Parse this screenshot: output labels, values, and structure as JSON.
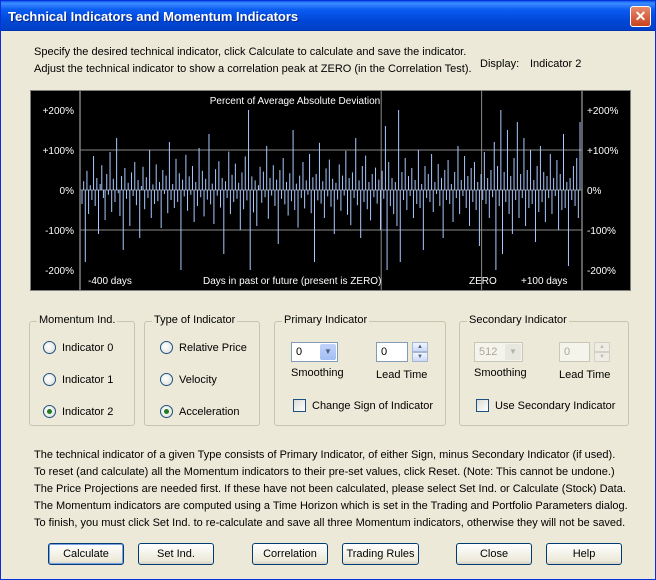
{
  "window": {
    "title": "Technical Indicators and Momentum Indicators",
    "close_label": "✕"
  },
  "instructions": {
    "line1": "Specify the desired technical indicator, click Calculate to calculate and save the indicator.",
    "line2": "Adjust the technical indicator to show a correlation peak at ZERO (in the Correlation Test).",
    "display_label": "Display:",
    "display_value": "Indicator 2"
  },
  "chart": {
    "title": "Percent of Average Absolute Deviation",
    "y_ticks": [
      "+200%",
      "+100%",
      "0%",
      "-100%",
      "-200%"
    ],
    "x_left_label": "-400 days",
    "x_center_label": "Days in past or future (present is ZERO)",
    "x_zero_label": "ZERO",
    "x_right_label": "+100 days",
    "line_color": "#a8c8ff"
  },
  "chart_data": {
    "type": "bar",
    "title": "Percent of Average Absolute Deviation",
    "xlabel": "Days in past or future (present is ZERO)",
    "ylabel": "",
    "x_range": [
      -400,
      100
    ],
    "ylim": [
      -200,
      200
    ],
    "y_unit": "%",
    "grid": true,
    "values": [
      -35,
      22,
      -180,
      48,
      -60,
      12,
      -25,
      85,
      -40,
      30,
      -110,
      15,
      62,
      -20,
      -75,
      40,
      -12,
      95,
      -55,
      28,
      -30,
      130,
      -8,
      -65,
      35,
      -150,
      55,
      -22,
      18,
      -90,
      44,
      -15,
      70,
      -38,
      25,
      -120,
      10,
      58,
      -48,
      32,
      -20,
      100,
      -70,
      14,
      -35,
      64,
      -28,
      20,
      -95,
      50,
      -10,
      36,
      -58,
      120,
      -25,
      15,
      -45,
      78,
      -30,
      42,
      -200,
      26,
      -16,
      88,
      -52,
      34,
      -12,
      60,
      -80,
      20,
      -40,
      105,
      -18,
      48,
      -66,
      28,
      -24,
      140,
      -36,
      16,
      -85,
      52,
      -14,
      72,
      -44,
      30,
      -160,
      22,
      -20,
      96,
      -60,
      38,
      -30,
      66,
      -22,
      18,
      -100,
      44,
      -48,
      84,
      -26,
      200,
      -200,
      34,
      -56,
      24,
      -90,
      12,
      58,
      -32,
      46,
      -18,
      110,
      -72,
      30,
      -14,
      62,
      -40,
      26,
      -135,
      50,
      -22,
      80,
      -36,
      20,
      -64,
      42,
      -28,
      150,
      -50,
      16,
      -94,
      36,
      -20,
      70,
      -46,
      24,
      -12,
      90,
      -58,
      32,
      -180,
      40,
      -26,
      118,
      -34,
      22,
      -70,
      54,
      -16,
      76,
      -42,
      28,
      -110,
      18,
      -24,
      64,
      -52,
      36,
      -14,
      98,
      -62,
      30,
      -88,
      44,
      -20,
      130,
      -38,
      24,
      -120,
      60,
      -30,
      86,
      -48,
      20,
      -76,
      40,
      -18,
      56,
      -34,
      26,
      -100,
      48,
      -22,
      160,
      -200,
      70,
      -40,
      30,
      -60,
      20,
      -90,
      200,
      -180,
      45,
      -25,
      80,
      -50,
      35,
      -15,
      55,
      -70,
      25,
      -35,
      100,
      -45,
      15,
      -150,
      60,
      -20,
      40,
      -30,
      90,
      -55,
      20,
      -10,
      65,
      -40,
      30,
      -120,
      50,
      -25,
      75,
      -35,
      15,
      -80,
      45,
      -20,
      110,
      -60,
      25,
      -15,
      85,
      -45,
      35,
      -90,
      55,
      -30,
      70,
      -50,
      20,
      -140,
      40,
      -25,
      95,
      -35,
      30,
      -70,
      50,
      -18,
      120,
      -200,
      60,
      -40,
      200,
      -160,
      45,
      -30,
      150,
      -60,
      35,
      -110,
      80,
      -25,
      170,
      -70,
      40,
      -20,
      130,
      -90,
      50,
      -45,
      100,
      -35,
      25,
      -130,
      60,
      -55,
      110,
      -30,
      45,
      -80,
      35,
      -20,
      90,
      -60,
      30,
      -15,
      75,
      -100,
      40,
      -50,
      140,
      -45,
      20,
      -190,
      30,
      -25,
      60,
      -40,
      80,
      -70,
      170
    ]
  },
  "momentum_group": {
    "title": "Momentum Ind.",
    "options": [
      {
        "label": "Indicator 0",
        "selected": false
      },
      {
        "label": "Indicator 1",
        "selected": false
      },
      {
        "label": "Indicator 2",
        "selected": true
      }
    ]
  },
  "type_group": {
    "title": "Type of Indicator",
    "options": [
      {
        "label": "Relative Price",
        "selected": false
      },
      {
        "label": "Velocity",
        "selected": false
      },
      {
        "label": "Acceleration",
        "selected": true
      }
    ]
  },
  "primary_group": {
    "title": "Primary Indicator",
    "smoothing_value": "0",
    "smoothing_label": "Smoothing",
    "lead_value": "0",
    "lead_label": "Lead Time",
    "checkbox_label": "Change Sign of Indicator"
  },
  "secondary_group": {
    "title": "Secondary Indicator",
    "smoothing_value": "512",
    "smoothing_label": "Smoothing",
    "lead_value": "0",
    "lead_label": "Lead Time",
    "checkbox_label": "Use Secondary Indicator"
  },
  "notes": [
    "The technical indicator of a given Type consists of Primary Indicator, of either Sign, minus Secondary Indicator (if used).",
    "To reset (and calculate) all the Momentum indicators to their pre-set values, click Reset.  (Note: This cannot be undone.)",
    "The Price Projections are needed first. If these have not been calculated, please select Set Ind. or Calculate (Stock) Data.",
    "The Momentum indicators are computed using a Time Horizon which is set in the Trading and Portfolio Parameters dialog.",
    "To finish, you must click Set Ind. to re-calculate and save all three Momentum indicators, otherwise they will not be saved."
  ],
  "buttons": {
    "calculate": "Calculate",
    "set_ind": "Set Ind.",
    "correlation": "Correlation",
    "trading_rules": "Trading Rules",
    "close": "Close",
    "help": "Help"
  }
}
